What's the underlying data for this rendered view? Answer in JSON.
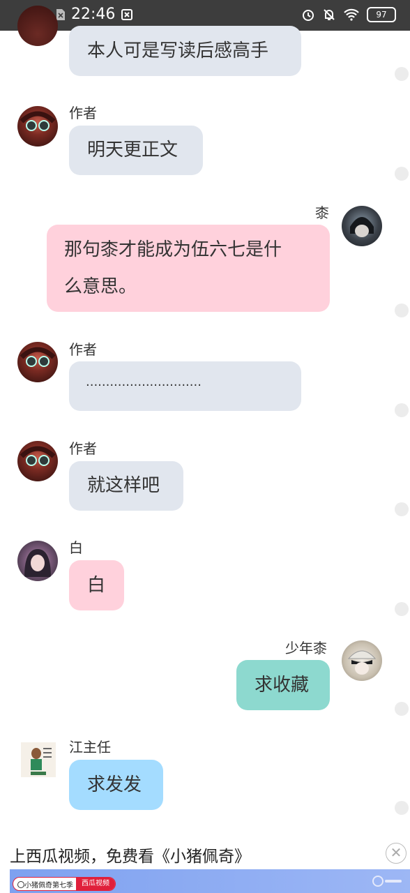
{
  "status_bar": {
    "time": "22:46",
    "battery": "97"
  },
  "messages": [
    {
      "name": "",
      "text": "本人可是写读后感高手"
    },
    {
      "name": "作者",
      "text": "明天更正文"
    },
    {
      "name": "桼",
      "line1": "那句桼才能成为伍六七是什",
      "line2": "么意思。"
    },
    {
      "name": "作者",
      "text": "·····························"
    },
    {
      "name": "作者",
      "text": "就这样吧"
    },
    {
      "name": "白",
      "text": "白"
    },
    {
      "name": "少年桼",
      "text": "求收藏"
    },
    {
      "name": "江主任",
      "text": "求发发"
    }
  ],
  "ad": {
    "text": "上西瓜视频，免费看《小猪佩奇》",
    "search_text": "小猪佩奇第七季",
    "button": "西瓜视频"
  }
}
